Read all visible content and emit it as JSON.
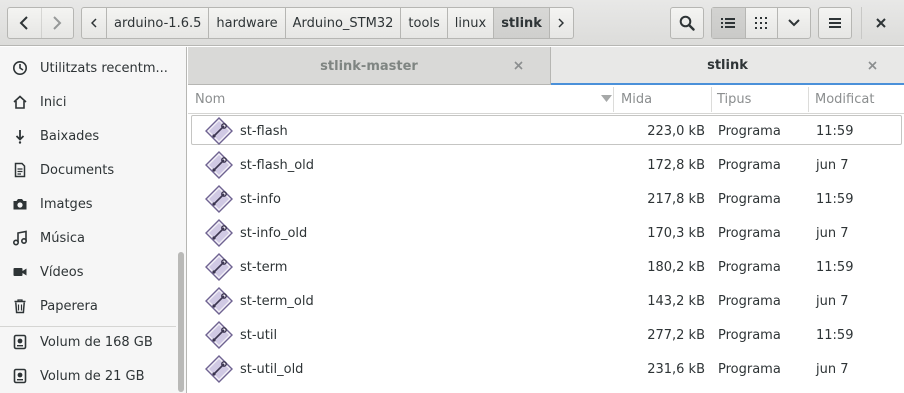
{
  "nav": {
    "back_icon": "chevron-left",
    "forward_icon": "chevron-right"
  },
  "pathbar": {
    "left_arrow_icon": "chevron-left",
    "segments": [
      "arduino-1.6.5",
      "hardware",
      "Arduino_STM32",
      "tools",
      "linux",
      "stlink"
    ],
    "right_arrow_icon": "chevron-right"
  },
  "toolbar": {
    "search_icon": "search-icon",
    "list_view_icon": "list-icon",
    "grid_view_icon": "grid-icon",
    "view_menu_icon": "chevron-down-icon",
    "menu_icon": "hamburger-icon",
    "close_icon": "close-icon"
  },
  "sidebar": {
    "items": [
      {
        "label": "Utilitzats recentm...",
        "icon": "clock-icon"
      },
      {
        "label": "Inici",
        "icon": "home-icon"
      },
      {
        "label": "Baixades",
        "icon": "download-icon"
      },
      {
        "label": "Documents",
        "icon": "document-icon"
      },
      {
        "label": "Imatges",
        "icon": "camera-icon"
      },
      {
        "label": "Música",
        "icon": "music-icon"
      },
      {
        "label": "Vídeos",
        "icon": "video-icon"
      },
      {
        "label": "Paperera",
        "icon": "trash-icon"
      },
      {
        "label": "Volum de 168 GB",
        "icon": "drive-icon"
      },
      {
        "label": "Volum de 21 GB",
        "icon": "drive-icon"
      }
    ]
  },
  "tabs": [
    {
      "label": "stlink-master",
      "active": false
    },
    {
      "label": "stlink",
      "active": true
    }
  ],
  "columns": {
    "name": "Nom",
    "size": "Mida",
    "type": "Tipus",
    "modified": "Modificat"
  },
  "files": [
    {
      "name": "st-flash",
      "size": "223,0 kB",
      "type": "Programa",
      "modified": "11:59"
    },
    {
      "name": "st-flash_old",
      "size": "172,8 kB",
      "type": "Programa",
      "modified": "jun 7"
    },
    {
      "name": "st-info",
      "size": "217,8 kB",
      "type": "Programa",
      "modified": "11:59"
    },
    {
      "name": "st-info_old",
      "size": "170,3 kB",
      "type": "Programa",
      "modified": "jun 7"
    },
    {
      "name": "st-term",
      "size": "180,2 kB",
      "type": "Programa",
      "modified": "11:59"
    },
    {
      "name": "st-term_old",
      "size": "143,2 kB",
      "type": "Programa",
      "modified": "jun 7"
    },
    {
      "name": "st-util",
      "size": "277,2 kB",
      "type": "Programa",
      "modified": "11:59"
    },
    {
      "name": "st-util_old",
      "size": "231,6 kB",
      "type": "Programa",
      "modified": "jun 7"
    }
  ],
  "colors": {
    "accent": "#4a90d9",
    "file_icon": "#8f7fbf"
  }
}
